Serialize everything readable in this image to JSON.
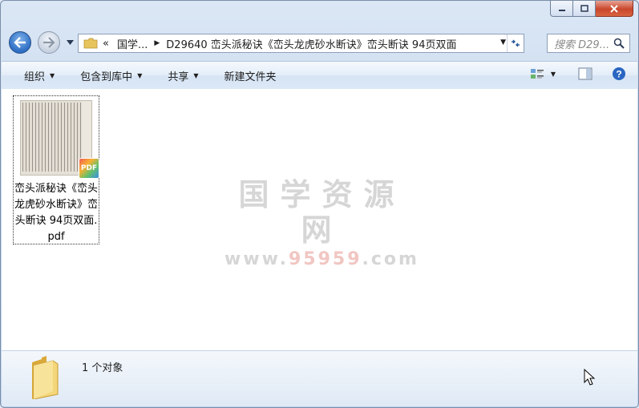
{
  "window": {
    "caption_buttons": [
      "minimize",
      "maximize",
      "close"
    ]
  },
  "address_bar": {
    "overflow": "«",
    "crumbs": [
      "国学...",
      "D29640 峦头派秘诀《峦头龙虎砂水断诀》峦头断诀 94页双面"
    ],
    "search_placeholder": "搜索 D29..."
  },
  "toolbar": {
    "organize": "组织",
    "include_in_library": "包含到库中",
    "share": "共享",
    "new_folder": "新建文件夹"
  },
  "files": [
    {
      "name": "峦头派秘诀《峦头龙虎砂水断诀》峦头断诀 94页双面.pdf",
      "type_badge": "PDF"
    }
  ],
  "watermark": {
    "line1": "国学资源网",
    "line2_prefix": "www.",
    "line2_number": "95959",
    "line2_suffix": ".com"
  },
  "details": {
    "count_text": "1 个对象"
  },
  "colors": {
    "accent": "#2d6ec4",
    "frame": "#bfd3ec",
    "close_red": "#c9462c"
  }
}
